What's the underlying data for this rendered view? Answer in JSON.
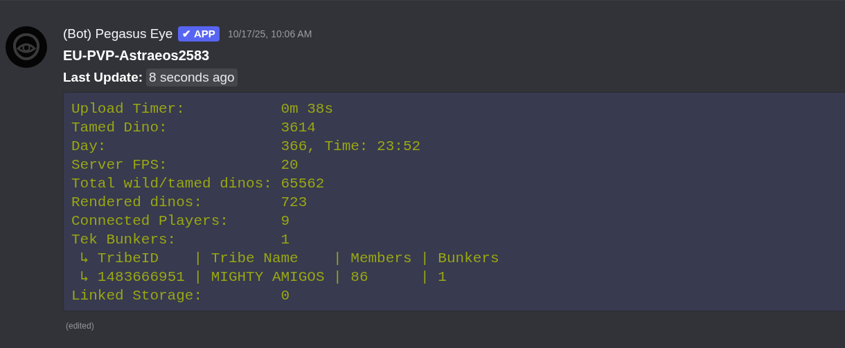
{
  "message": {
    "author": "(Bot) Pegasus Eye",
    "badge": {
      "check": "✔",
      "label": "APP"
    },
    "timestamp": "10/17/25, 10:06 AM",
    "title": "EU-PVP-Astraeos2583",
    "update": {
      "label": "Last Update:",
      "value": "8 seconds ago"
    },
    "code_block": {
      "lines": [
        "Upload Timer:           0m 38s",
        "Tamed Dino:             3614",
        "Day:                    366, Time: 23:52",
        "Server FPS:             20",
        "Total wild/tamed dinos: 65562",
        "Rendered dinos:         723",
        "Connected Players:      9",
        "Tek Bunkers:            1",
        " ↳ TribeID    | Tribe Name    | Members | Bunkers",
        " ↳ 1483666951 | MIGHTY AMIGOS | 86      | 1",
        "Linked Storage:         0"
      ]
    },
    "edited": "(edited)"
  }
}
